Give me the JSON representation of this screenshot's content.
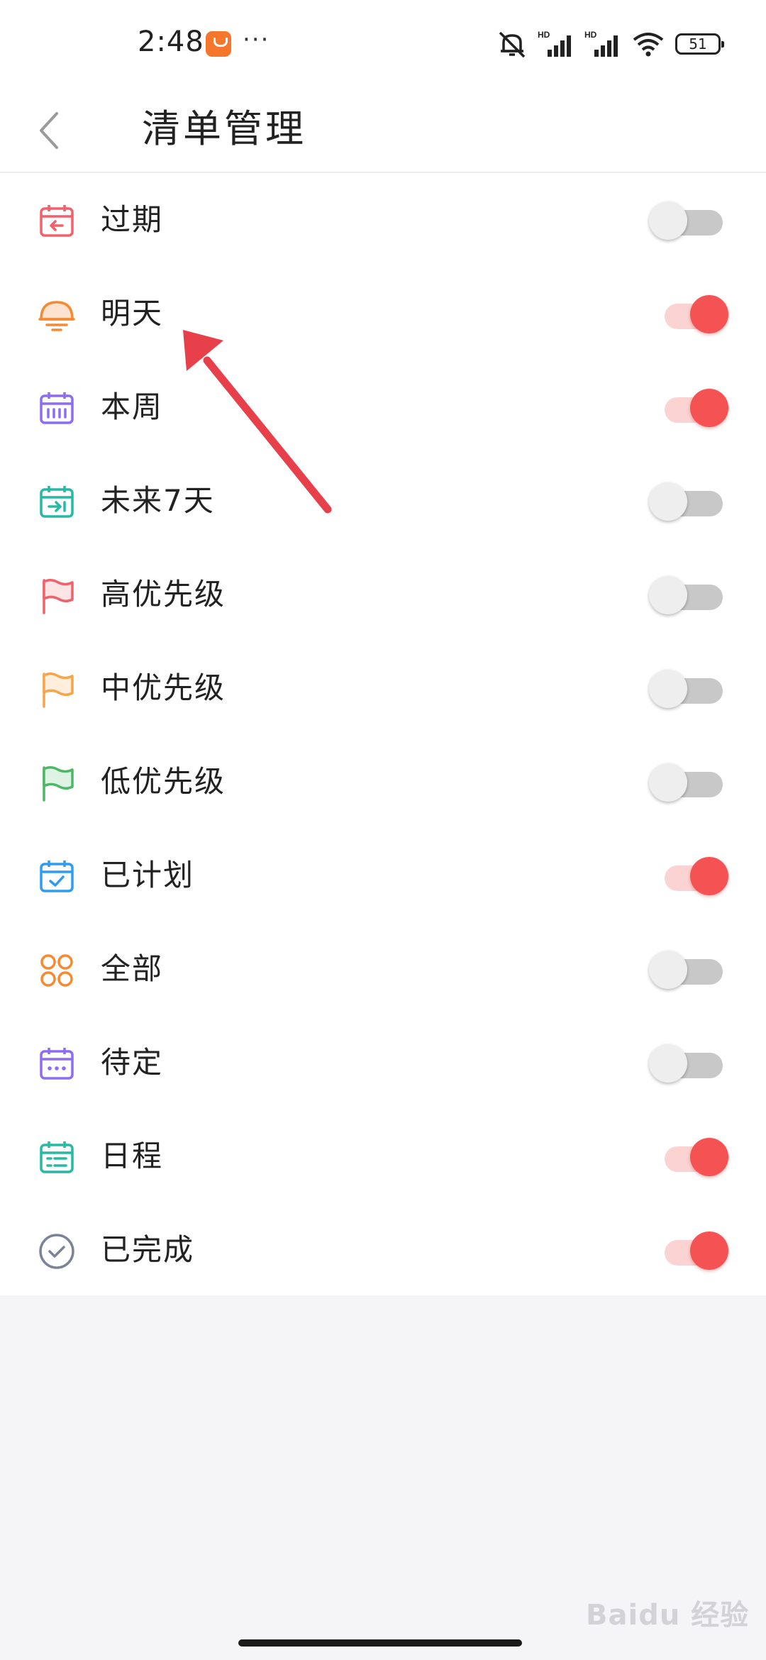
{
  "status_bar": {
    "time": "2:48",
    "dots": "···",
    "battery": "51",
    "network_label": "HD"
  },
  "header": {
    "title": "清单管理"
  },
  "lists": [
    {
      "label": "过期",
      "icon": "calendar-overdue-icon",
      "color": "#f0616a",
      "enabled": false
    },
    {
      "label": "明天",
      "icon": "sunrise-icon",
      "color": "#f58a33",
      "enabled": true
    },
    {
      "label": "本周",
      "icon": "calendar-week-icon",
      "color": "#8b6cf2",
      "enabled": true
    },
    {
      "label": "未来7天",
      "icon": "calendar-next7-icon",
      "color": "#27b9a3",
      "enabled": false
    },
    {
      "label": "高优先级",
      "icon": "flag-high-icon",
      "color": "#f0616a",
      "enabled": false
    },
    {
      "label": "中优先级",
      "icon": "flag-medium-icon",
      "color": "#f7a54a",
      "enabled": false
    },
    {
      "label": "低优先级",
      "icon": "flag-low-icon",
      "color": "#4cb866",
      "enabled": false
    },
    {
      "label": "已计划",
      "icon": "calendar-check-icon",
      "color": "#2e9cf0",
      "enabled": true
    },
    {
      "label": "全部",
      "icon": "grid-circles-icon",
      "color": "#f58a33",
      "enabled": false
    },
    {
      "label": "待定",
      "icon": "calendar-pending-icon",
      "color": "#8b6cf2",
      "enabled": false
    },
    {
      "label": "日程",
      "icon": "calendar-agenda-icon",
      "color": "#27b9a3",
      "enabled": true
    },
    {
      "label": "已完成",
      "icon": "check-circle-icon",
      "color": "#7c8397",
      "enabled": true
    }
  ],
  "colors": {
    "toggle_on": "#f55254",
    "toggle_on_track": "#fcd3d3",
    "toggle_off_track": "#c8c8c8",
    "annotation_arrow": "#e8404a"
  },
  "watermark": "Baidu 经验"
}
